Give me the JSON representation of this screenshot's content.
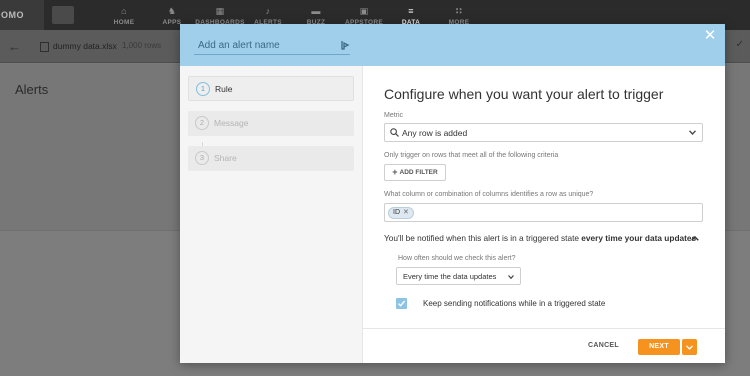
{
  "app": {
    "logo_text": "DOMO",
    "nav": [
      {
        "label": "HOME",
        "icon": "home-icon",
        "glyph": "⌂"
      },
      {
        "label": "APPS",
        "icon": "apps-icon",
        "glyph": "♞"
      },
      {
        "label": "DASHBOARDS",
        "icon": "dashboards-icon",
        "glyph": "▦"
      },
      {
        "label": "ALERTS",
        "icon": "bell-icon",
        "glyph": "♪"
      },
      {
        "label": "BUZZ",
        "icon": "chat-icon",
        "glyph": "▬"
      },
      {
        "label": "APPSTORE",
        "icon": "appstore-icon",
        "glyph": "▣"
      },
      {
        "label": "DATA",
        "icon": "data-icon",
        "glyph": "≡"
      },
      {
        "label": "MORE",
        "icon": "grid-icon",
        "glyph": "∷"
      }
    ],
    "active_nav": "DATA"
  },
  "subbar": {
    "file_name": "dummy data.xlsx",
    "row_count": "1,000 rows"
  },
  "page": {
    "title": "Alerts"
  },
  "modal": {
    "name_placeholder": "Add an alert name",
    "steps": [
      {
        "num": "1",
        "label": "Rule"
      },
      {
        "num": "2",
        "label": "Message"
      },
      {
        "num": "3",
        "label": "Share"
      }
    ],
    "heading": "Configure when you want your alert to trigger",
    "metric_label": "Metric",
    "metric_value": "Any row is added",
    "criteria_label": "Only trigger on rows that meet all of the following criteria",
    "add_filter_label": "ADD FILTER",
    "unique_label": "What column or combination of columns identifies a row as unique?",
    "unique_tags": [
      "ID"
    ],
    "notify_prefix": "You'll be notified when this alert is in a triggered state ",
    "notify_bold": "every time your data updates",
    "how_often_label": "How often should we check this alert?",
    "frequency_value": "Every time the data updates",
    "keep_sending_label": "Keep sending notifications while in a triggered state",
    "keep_sending_checked": true,
    "cancel_label": "CANCEL",
    "next_label": "NEXT"
  },
  "colors": {
    "header_blue": "#9fcfea",
    "accent_orange": "#f6931e",
    "checkbox_blue": "#8dc3e3"
  }
}
